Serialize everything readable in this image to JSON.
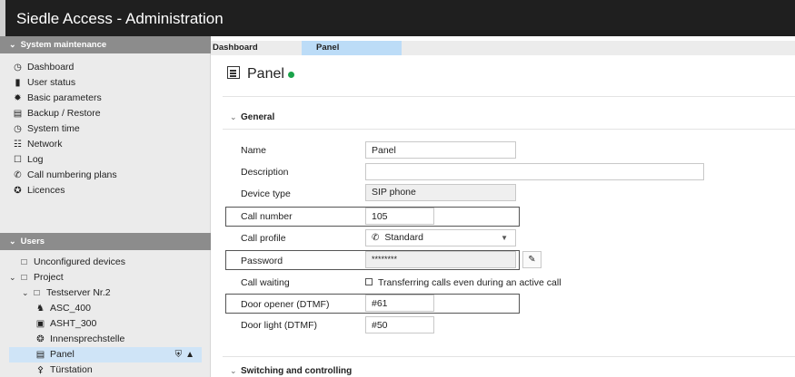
{
  "app": {
    "title": "Siedle Access - Administration"
  },
  "sidebar": {
    "system_section": "System maintenance",
    "system_items": [
      {
        "label": "Dashboard",
        "icon": "dashboard-icon"
      },
      {
        "label": "User status",
        "icon": "user-status-icon"
      },
      {
        "label": "Basic parameters",
        "icon": "gear-icon"
      },
      {
        "label": "Backup / Restore",
        "icon": "backup-icon"
      },
      {
        "label": "System time",
        "icon": "clock-icon"
      },
      {
        "label": "Network",
        "icon": "network-icon"
      },
      {
        "label": "Log",
        "icon": "log-icon"
      },
      {
        "label": "Call numbering plans",
        "icon": "phone-icon"
      },
      {
        "label": "Licences",
        "icon": "licence-icon"
      }
    ],
    "users_section": "Users",
    "tree": [
      {
        "label": "Unconfigured devices",
        "icon": "folder-icon"
      },
      {
        "label": "Project",
        "icon": "folder-icon"
      },
      {
        "label": "Testserver Nr.2",
        "icon": "folder-icon"
      },
      {
        "label": "ASC_400",
        "icon": "device-icon"
      },
      {
        "label": "ASHT_300",
        "icon": "handset-icon"
      },
      {
        "label": "Innensprechstelle",
        "icon": "intercom-icon"
      },
      {
        "label": "Panel",
        "icon": "panel-icon"
      },
      {
        "label": "Türstation",
        "icon": "key-icon"
      }
    ]
  },
  "tabs": [
    {
      "label": "Dashboard"
    },
    {
      "label": "Panel"
    }
  ],
  "page": {
    "title": "Panel",
    "status_color": "#1aa34a",
    "group_general": "General",
    "group_switching": "Switching and controlling"
  },
  "form": {
    "name_label": "Name",
    "name_value": "Panel",
    "description_label": "Description",
    "description_value": "",
    "device_type_label": "Device type",
    "device_type_value": "SIP phone",
    "call_number_label": "Call number",
    "call_number_value": "105",
    "call_profile_label": "Call profile",
    "call_profile_value": "Standard",
    "password_label": "Password",
    "password_value": "********",
    "call_waiting_label": "Call waiting",
    "call_waiting_text": "Transferring calls even during an active call",
    "door_opener_label": "Door opener (DTMF)",
    "door_opener_value": "#61",
    "door_light_label": "Door light (DTMF)",
    "door_light_value": "#50"
  }
}
